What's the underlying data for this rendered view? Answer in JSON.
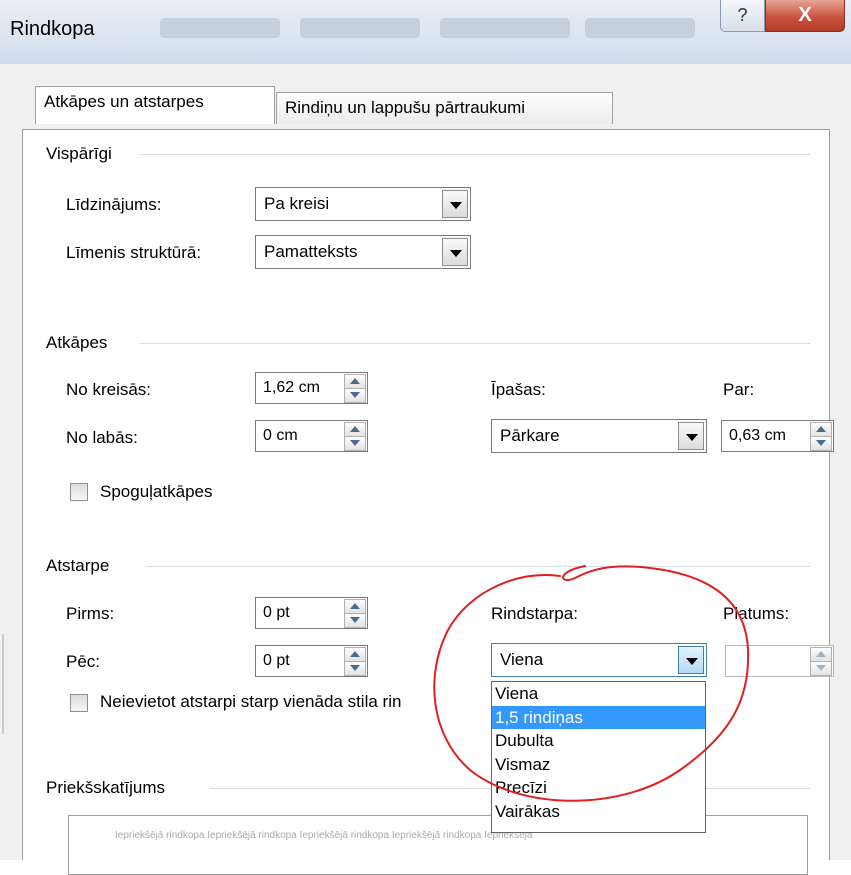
{
  "window": {
    "title": "Rindkopa",
    "help_label": "?",
    "close_label": "X"
  },
  "tabs": [
    {
      "label": "Atkāpes un atstarpes",
      "active": true
    },
    {
      "label": "Rindiņu un lappušu pārtraukumi",
      "active": false
    }
  ],
  "general": {
    "group_label": "Vispārīgi",
    "alignment_label": "Līdzinājums:",
    "alignment_value": "Pa kreisi",
    "outline_label": "Līmenis struktūrā:",
    "outline_value": "Pamatteksts"
  },
  "indent": {
    "group_label": "Atkāpes",
    "left_label": "No kreisās:",
    "left_value": "1,62 cm",
    "right_label": "No labās:",
    "right_value": "0 cm",
    "special_label": "Īpašas:",
    "special_value": "Pārkare",
    "by_label": "Par:",
    "by_value": "0,63 cm",
    "mirror_label": "Spoguļatkāpes",
    "mirror_checked": false
  },
  "spacing": {
    "group_label": "Atstarpe",
    "before_label": "Pirms:",
    "before_value": "0 pt",
    "after_label": "Pēc:",
    "after_value": "0 pt",
    "line_spacing_label": "Rindstarpa:",
    "line_spacing_value": "Viena",
    "at_label": "Platums:",
    "at_value": "",
    "no_space_label": "Neievietot atstarpi starp vienāda stila rin",
    "no_space_checked": false
  },
  "line_spacing_options": [
    {
      "label": "Viena",
      "selected": false
    },
    {
      "label": "1,5 rindiņas",
      "selected": true
    },
    {
      "label": "Dubulta",
      "selected": false
    },
    {
      "label": "Vismaz",
      "selected": false
    },
    {
      "label": "Precīzi",
      "selected": false
    },
    {
      "label": "Vairākas",
      "selected": false
    }
  ],
  "preview": {
    "group_label": "Priekšskatījums",
    "text": "Iepriekšējā rindkopa Iepriekšējā rindkopa Iepriekšējā rindkopa Iepriekšējā rindkopa Iepriekšējā"
  },
  "colors": {
    "selection": "#3399ff",
    "annotation": "#e02020"
  }
}
